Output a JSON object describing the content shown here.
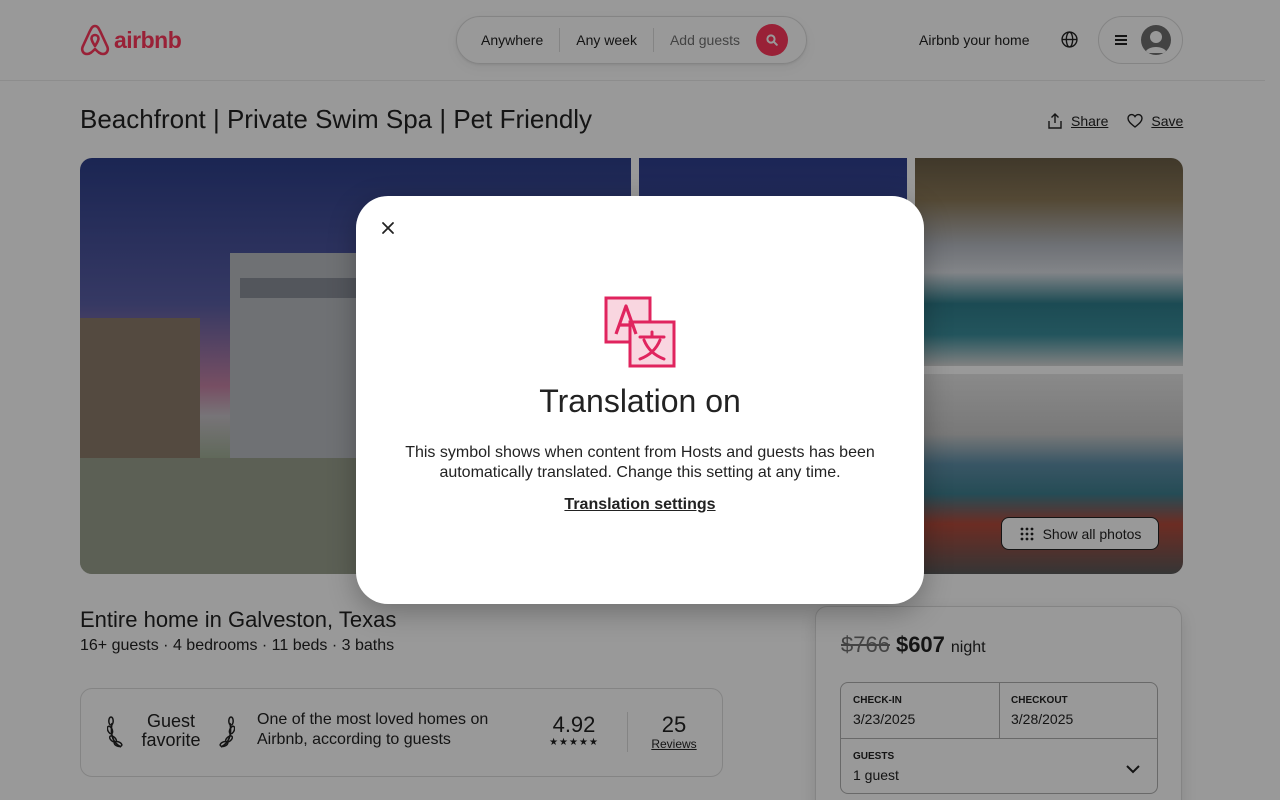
{
  "brand": {
    "name": "airbnb",
    "color": "#ff385c"
  },
  "search": {
    "where": "Anywhere",
    "when": "Any week",
    "guests_placeholder": "Add guests"
  },
  "nav": {
    "host_link": "Airbnb your home"
  },
  "listing": {
    "title": "Beachfront | Private Swim Spa | Pet Friendly",
    "share_label": "Share",
    "save_label": "Save",
    "show_all_photos": "Show all photos",
    "home_title": "Entire home in Galveston, Texas",
    "home_sub": "16+ guests · 4 bedrooms · 11 beds · 3 baths"
  },
  "guest_favorite": {
    "badge_line1": "Guest",
    "badge_line2": "favorite",
    "description": "One of the most loved homes on Airbnb, according to guests",
    "rating": "4.92",
    "stars": "★★★★★",
    "review_count": "25",
    "reviews_label": "Reviews"
  },
  "booking": {
    "old_price": "$766",
    "new_price": "$607",
    "per": "night",
    "checkin_label": "CHECK-IN",
    "checkin_value": "3/23/2025",
    "checkout_label": "CHECKOUT",
    "checkout_value": "3/28/2025",
    "guests_label": "GUESTS",
    "guests_value": "1 guest"
  },
  "modal": {
    "title": "Translation on",
    "body": "This symbol shows when content from Hosts and guests has been automatically translated. Change this setting at any time.",
    "link": "Translation settings",
    "icon": "translate-icon"
  }
}
